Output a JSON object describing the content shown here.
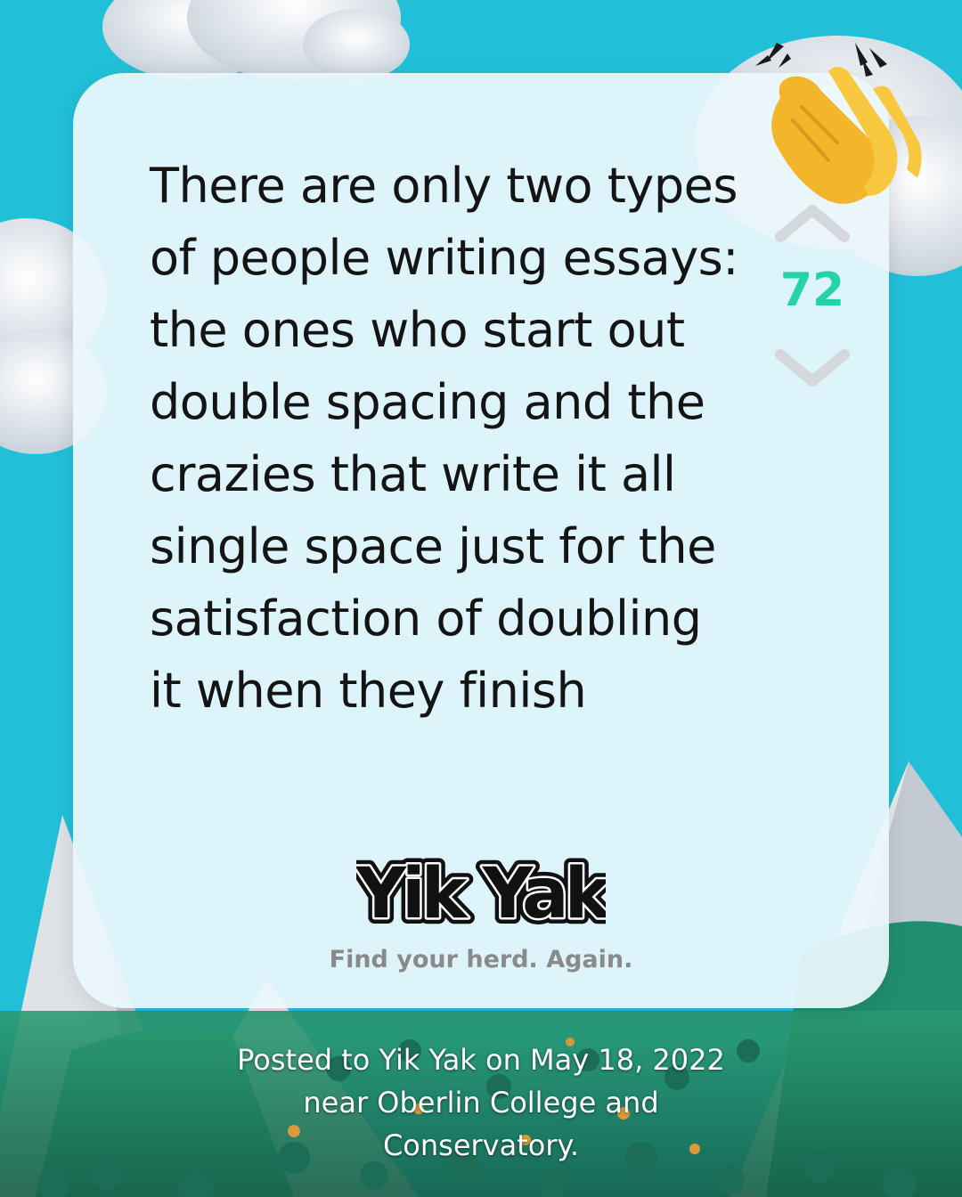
{
  "post": {
    "text_lines": [
      "There are only two types",
      "of people writing essays:",
      "the ones who start out",
      "double spacing and the",
      "crazies that write it all",
      "single space just for the",
      "satisfaction of doubling",
      "it when they finish"
    ],
    "vote_count": "72"
  },
  "brand": {
    "logo_text": "Yik Yak",
    "tagline": "Find your herd. Again."
  },
  "footer": {
    "lines": [
      "Posted to Yik Yak on May 18, 2022",
      "near Oberlin College and",
      "Conservatory."
    ]
  },
  "icons": {
    "emoji": "clapping-hands-icon",
    "upvote": "chevron-up-icon",
    "downvote": "chevron-down-icon"
  },
  "colors": {
    "background": "#22bfd9",
    "card": "#ecf8fc",
    "vote_count": "#24d3a6",
    "text": "#141414",
    "tagline": "#8a8a8a",
    "mountain_green": "#1f9a78"
  }
}
